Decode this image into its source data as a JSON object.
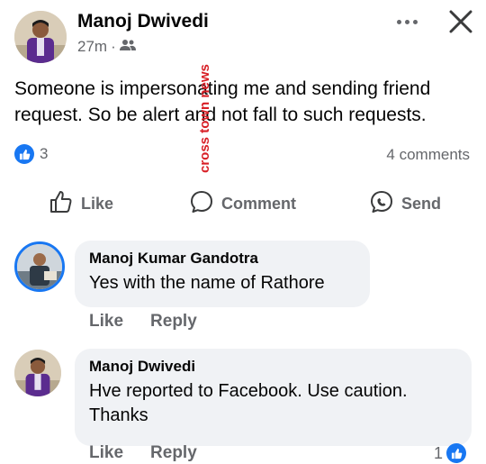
{
  "post": {
    "author": "Manoj Dwivedi",
    "time": "27m",
    "separator": "·",
    "audience_icon": "friends-icon",
    "text": "Someone is impersonating me and sending friend request. So be alert and not fall to such requests.",
    "reaction_count": "3",
    "comments_count": "4 comments"
  },
  "actions": {
    "like": "Like",
    "comment": "Comment",
    "send": "Send"
  },
  "watermark": "cross town news",
  "comments": [
    {
      "author": "Manoj Kumar Gandotra",
      "text": "Yes with the name of Rathore",
      "like": "Like",
      "reply": "Reply"
    },
    {
      "author": "Manoj Dwivedi",
      "text": "Hve reported to Facebook. Use caution. Thanks",
      "like": "Like",
      "reply": "Reply",
      "reaction_count": "1"
    }
  ],
  "colors": {
    "accent": "#1877f2",
    "secondary_text": "#65676b",
    "bubble": "#f0f2f5",
    "watermark": "#d81f26"
  }
}
